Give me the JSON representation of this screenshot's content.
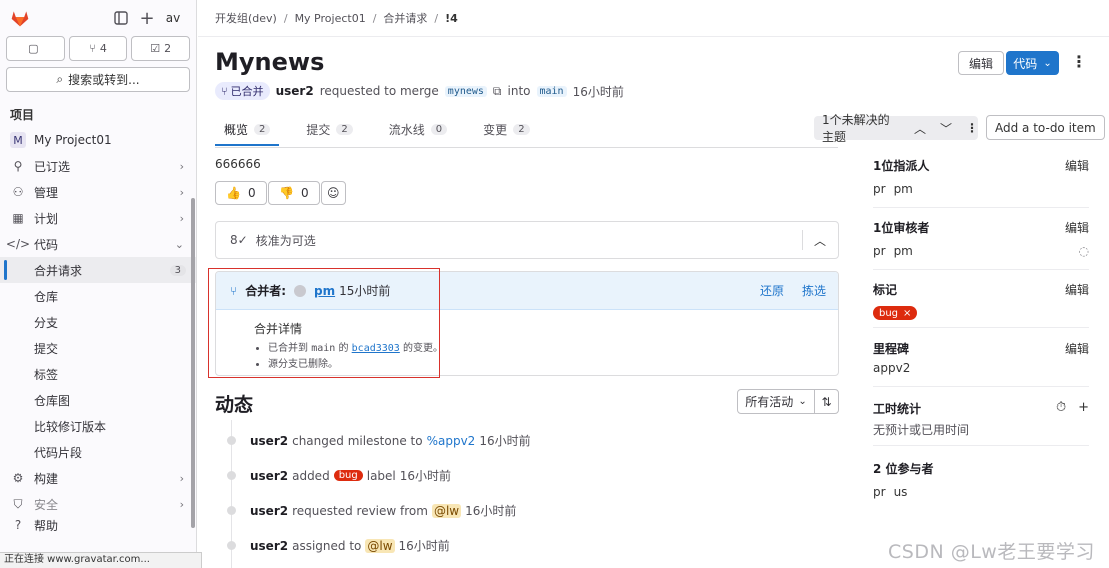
{
  "sidebar": {
    "counts": [
      {
        "icon": "merge-request-icon",
        "value": ""
      },
      {
        "icon": "merge-icon",
        "value": "4"
      },
      {
        "icon": "todo-icon",
        "value": "2"
      }
    ],
    "top_avatar": "av",
    "search_label": "搜索或转到...",
    "section_label": "项目",
    "project_initial": "M",
    "project_name": "My Project01",
    "items": [
      {
        "label": "已订选",
        "icon": "pin-icon"
      },
      {
        "label": "管理",
        "icon": "manage-icon"
      },
      {
        "label": "计划",
        "icon": "plan-icon"
      },
      {
        "label": "代码",
        "icon": "code-icon"
      }
    ],
    "code_sub": [
      "合并请求",
      "仓库",
      "分支",
      "提交",
      "标签",
      "仓库图",
      "比较修订版本",
      "代码片段"
    ],
    "mr_count": "3",
    "bottom_items": [
      {
        "label": "构建",
        "icon": "build-icon"
      },
      {
        "label": "安全",
        "icon": "shield-icon"
      },
      {
        "label": "帮助",
        "icon": "help-icon"
      }
    ]
  },
  "statusbar": "正在连接 www.gravatar.com...",
  "breadcrumb": [
    "开发组(dev)",
    "My Project01",
    "合并请求",
    "!4"
  ],
  "mr": {
    "title": "Mynews",
    "edit_label": "编辑",
    "code_label": "代码",
    "merged_badge": "已合并",
    "author": "user2",
    "requested_text": "requested to merge",
    "source_branch": "mynews",
    "into_text": "into",
    "target_branch": "main",
    "time": "16小时前",
    "tabs": [
      {
        "label": "概览",
        "count": "2"
      },
      {
        "label": "提交",
        "count": "2"
      },
      {
        "label": "流水线",
        "count": "0"
      },
      {
        "label": "变更",
        "count": "2"
      }
    ],
    "unresolved": "1个未解决的主题",
    "todo": "Add a to-do item",
    "description": "666666",
    "thumbs_up": "0",
    "thumbs_down": "0",
    "approval_text": "核准为可选",
    "merged_by_label": "合并者:",
    "merged_by_user": "pm",
    "merged_time": "15小时前",
    "revert": "还原",
    "cherry_pick": "拣选",
    "merge_details_title": "合并详情",
    "merge_detail_1_pre": "已合并到",
    "merge_detail_1_branch": "main",
    "merge_detail_1_mid": "的",
    "merge_detail_1_commit": "bcad3303",
    "merge_detail_1_post": "的变更。",
    "merge_detail_2": "源分支已删除。"
  },
  "activity": {
    "title": "动态",
    "filter": "所有活动",
    "events": [
      {
        "user": "user2",
        "parts": [
          "changed milestone to"
        ],
        "ref": "%appv2",
        "time": "16小时前"
      },
      {
        "user": "user2",
        "pre": "added",
        "label": "bug",
        "post": "label",
        "time": "16小时前"
      },
      {
        "user": "user2",
        "pre": "requested review from",
        "mention": "@lw",
        "time": "16小时前"
      },
      {
        "user": "user2",
        "pre": "assigned to",
        "mention": "@lw",
        "time": "16小时前"
      }
    ]
  },
  "right_panel": {
    "assignee_title": "1位指派人",
    "assignee_initials": "pr",
    "assignee_name": "pm",
    "reviewer_title": "1位审核者",
    "reviewer_initials": "pr",
    "reviewer_name": "pm",
    "labels_title": "标记",
    "label_name": "bug",
    "milestone_title": "里程碑",
    "milestone_value": "appv2",
    "time_title": "工时统计",
    "time_value": "无预计或已用时间",
    "participants_title": "2 位参与者",
    "participants": [
      "pr",
      "us"
    ],
    "edit": "编辑"
  },
  "watermark": "CSDN @Lw老王要学习",
  "colors": {
    "accent": "#1f75cb",
    "danger": "#dd2b0e",
    "highlight_box": "#d8322c"
  }
}
